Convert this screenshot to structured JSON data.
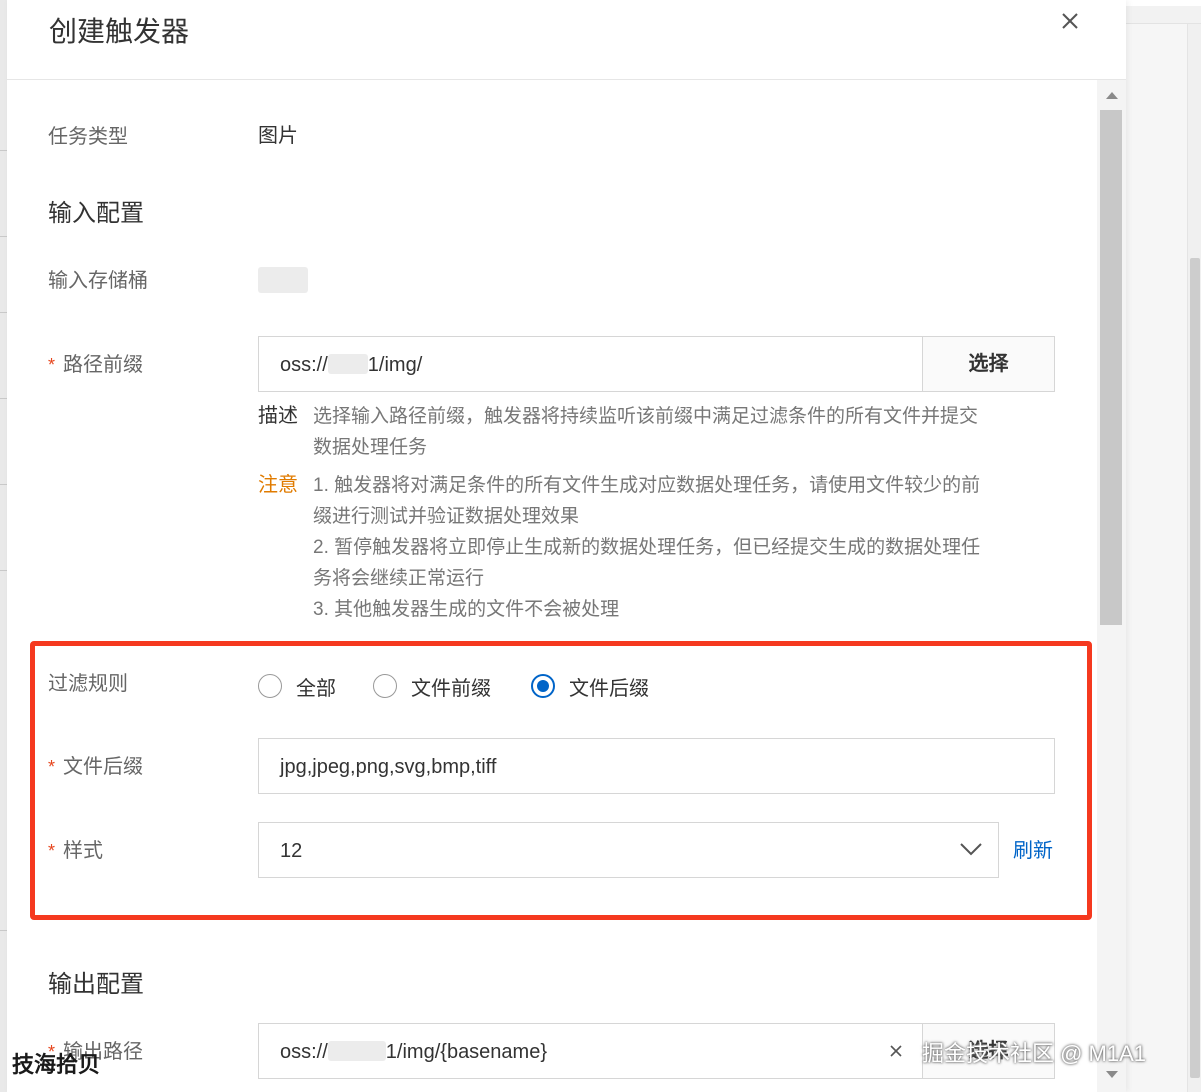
{
  "dialog": {
    "title": "创建触发器",
    "close_icon": "close-icon"
  },
  "task_type": {
    "label": "任务类型",
    "value": "图片"
  },
  "input_section": {
    "title": "输入配置"
  },
  "input_bucket": {
    "label": "输入存储桶"
  },
  "path_prefix": {
    "label": "路径前缀",
    "value_start": "oss://",
    "value_end": "1/img/",
    "select_label": "选择"
  },
  "description": {
    "key": "描述",
    "line1": "选择输入路径前缀，触发器将持续监听该前缀中满足过滤条件的所有文件并提交",
    "line2": "数据处理任务"
  },
  "notice": {
    "key": "注意",
    "key_color": "#e07b00",
    "lines": [
      "1. 触发器将对满足条件的所有文件生成对应数据处理任务，请使用文件较少的前",
      "缀进行测试并验证数据处理效果",
      "2. 暂停触发器将立即停止生成新的数据处理任务，但已经提交生成的数据处理任",
      "务将会继续正常运行",
      "3. 其他触发器生成的文件不会被处理"
    ]
  },
  "filter_rule": {
    "label": "过滤规则",
    "options": [
      "全部",
      "文件前缀",
      "文件后缀"
    ],
    "selected": "文件后缀"
  },
  "file_suffix": {
    "label": "文件后缀",
    "value": "jpg,jpeg,png,svg,bmp,tiff"
  },
  "style": {
    "label": "样式",
    "value": "12",
    "refresh_label": "刷新"
  },
  "output_section": {
    "title": "输出配置"
  },
  "output_path": {
    "label": "输出路径",
    "value_start": "oss://",
    "value_end": "1/img/{basename}",
    "clear_icon": "clear-icon",
    "select_label": "选择"
  },
  "watermark": {
    "left": "技海拾贝",
    "right": "掘金技术社区 @ M1A1"
  },
  "colors": {
    "accent": "#0064c8",
    "required": "#e6461e",
    "highlight_box": "#f5391f"
  }
}
